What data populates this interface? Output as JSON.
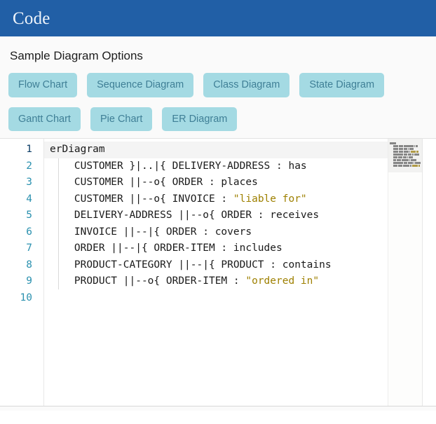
{
  "header": {
    "title": "Code",
    "bg_color": "#215fa6",
    "text_color": "#eef4fb"
  },
  "options": {
    "title": "Sample Diagram Options",
    "button_bg": "#a4dae3",
    "button_text_color": "#3f7f96",
    "buttons": [
      {
        "label": "Flow Chart"
      },
      {
        "label": "Sequence Diagram"
      },
      {
        "label": "Class Diagram"
      },
      {
        "label": "State Diagram"
      },
      {
        "label": "Gantt Chart"
      },
      {
        "label": "Pie Chart"
      },
      {
        "label": "ER Diagram"
      }
    ]
  },
  "editor": {
    "active_line": 1,
    "string_color": "#9e8000",
    "line_number_color": "#2b91af",
    "active_line_number_color": "#0b3d66",
    "line_numbers": [
      "1",
      "2",
      "3",
      "4",
      "5",
      "6",
      "7",
      "8",
      "9",
      "10"
    ],
    "lines": [
      {
        "n": "1",
        "indent": "",
        "text": "erDiagram",
        "string": ""
      },
      {
        "n": "2",
        "indent": "    ",
        "text": "CUSTOMER }|..|{ DELIVERY-ADDRESS : has",
        "string": ""
      },
      {
        "n": "3",
        "indent": "    ",
        "text": "CUSTOMER ||--o{ ORDER : places",
        "string": ""
      },
      {
        "n": "4",
        "indent": "    ",
        "text": "CUSTOMER ||--o{ INVOICE : ",
        "string": "\"liable for\""
      },
      {
        "n": "5",
        "indent": "    ",
        "text": "DELIVERY-ADDRESS ||--o{ ORDER : receives",
        "string": ""
      },
      {
        "n": "6",
        "indent": "    ",
        "text": "INVOICE ||--|{ ORDER : covers",
        "string": ""
      },
      {
        "n": "7",
        "indent": "    ",
        "text": "ORDER ||--|{ ORDER-ITEM : includes",
        "string": ""
      },
      {
        "n": "8",
        "indent": "    ",
        "text": "PRODUCT-CATEGORY ||--|{ PRODUCT : contains",
        "string": ""
      },
      {
        "n": "9",
        "indent": "    ",
        "text": "PRODUCT ||--o{ ORDER-ITEM : ",
        "string": "\"ordered in\""
      },
      {
        "n": "10",
        "indent": "",
        "text": "",
        "string": ""
      }
    ],
    "minimap": {
      "visible": true,
      "slider_at_top": true
    }
  }
}
